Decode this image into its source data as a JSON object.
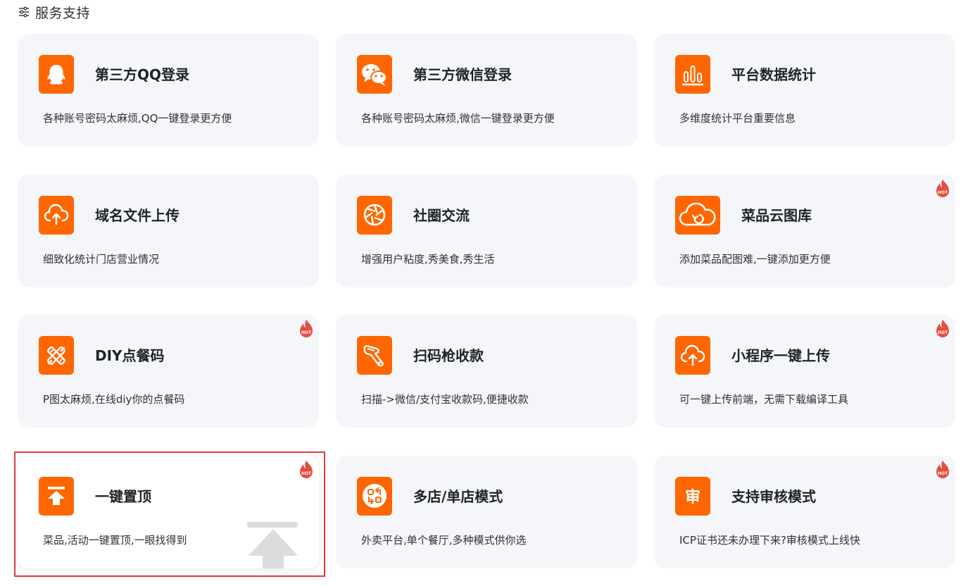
{
  "header": {
    "title": "服务支持",
    "icon": "sliders-icon"
  },
  "colors": {
    "accent": "#ff6600",
    "card_bg": "#f5f6fa",
    "hot": "#e84c3d",
    "highlight_border": "#e23a3a"
  },
  "cards": [
    {
      "title": "第三方QQ登录",
      "desc": "各种账号密码太麻烦,QQ一键登录更方便",
      "icon": "qq-icon",
      "hot": false
    },
    {
      "title": "第三方微信登录",
      "desc": "各种账号密码太麻烦,微信一键登录更方便",
      "icon": "wechat-icon",
      "hot": false
    },
    {
      "title": "平台数据统计",
      "desc": "多维度统计平台重要信息",
      "icon": "bar-chart-icon",
      "hot": false
    },
    {
      "title": "域名文件上传",
      "desc": "细致化统计门店营业情况",
      "icon": "cloud-upload-icon",
      "hot": false
    },
    {
      "title": "社圈交流",
      "desc": "增强用户粘度,秀美食,秀生活",
      "icon": "aperture-icon",
      "hot": false
    },
    {
      "title": "菜品云图库",
      "desc": "添加菜品配图难,一键添加更方便",
      "icon": "cloud-download-icon",
      "hot": true
    },
    {
      "title": "DIY点餐码",
      "desc": "P图太麻烦,在线diy你的点餐码",
      "icon": "design-tools-icon",
      "hot": true
    },
    {
      "title": "扫码枪收款",
      "desc": "扫描->微信/支付宝收款码,便捷收款",
      "icon": "barcode-scanner-icon",
      "hot": false
    },
    {
      "title": "小程序一键上传",
      "desc": "可一键上传前端，无需下载编译工具",
      "icon": "cloud-upload-icon",
      "hot": true
    },
    {
      "title": "一键置顶",
      "desc": "菜品,活动一键置顶,一眼找得到",
      "icon": "pin-top-icon",
      "hot": true,
      "active": true
    },
    {
      "title": "多店/单店模式",
      "desc": "外卖平台,单个餐厅,多种模式供你选",
      "icon": "switch-mode-icon",
      "hot": false
    },
    {
      "title": "支持审核模式",
      "desc": "ICP证书还未办理下来?审核模式上线快",
      "icon": "review-icon",
      "icon_text": "审",
      "hot": true
    }
  ],
  "badge": {
    "hot_label": "HOT"
  }
}
